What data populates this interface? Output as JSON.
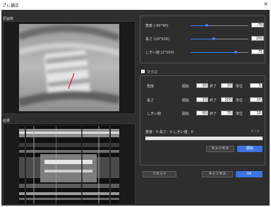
{
  "window": {
    "title": "ブレ補正",
    "close_glyph": "×"
  },
  "preview_panel": {
    "label": "原画像"
  },
  "result_panel": {
    "label": "結果"
  },
  "sliders": [
    {
      "label": "角度 (-90°90)",
      "value": "-70",
      "fraction": 0.28
    },
    {
      "label": "長さ (10°500)",
      "value": "150",
      "fraction": 0.4
    },
    {
      "label": "しきい値 (1°100)",
      "value": "75",
      "fraction": 0.78
    }
  ],
  "macro": {
    "checkbox_label": "マクロ",
    "checked": true,
    "rows": [
      {
        "label": "角度",
        "start_label": "開始",
        "start": "-30",
        "end_label": "終了",
        "end": "10",
        "unit_label": "単位",
        "unit": "5"
      },
      {
        "label": "長さ",
        "start_label": "開始",
        "start": "10",
        "end_label": "終了",
        "end": "200",
        "unit_label": "単位",
        "unit": "10"
      },
      {
        "label": "しきい値",
        "start_label": "開始",
        "start": "60",
        "end_label": "終了",
        "end": "70",
        "unit_label": "単位",
        "unit": "10"
      }
    ],
    "status_text": "角度：0 長さ：0 しきい値：0",
    "counter": "0 / 0",
    "progress": 0,
    "cancel_label": "キャンセル",
    "start_label": "開始"
  },
  "footer": {
    "reset_label": "リセット",
    "cancel_label": "キャンセル",
    "ok_label": "OK"
  },
  "colors": {
    "accent": "#3b82f6",
    "background": "#2e2e2e"
  }
}
